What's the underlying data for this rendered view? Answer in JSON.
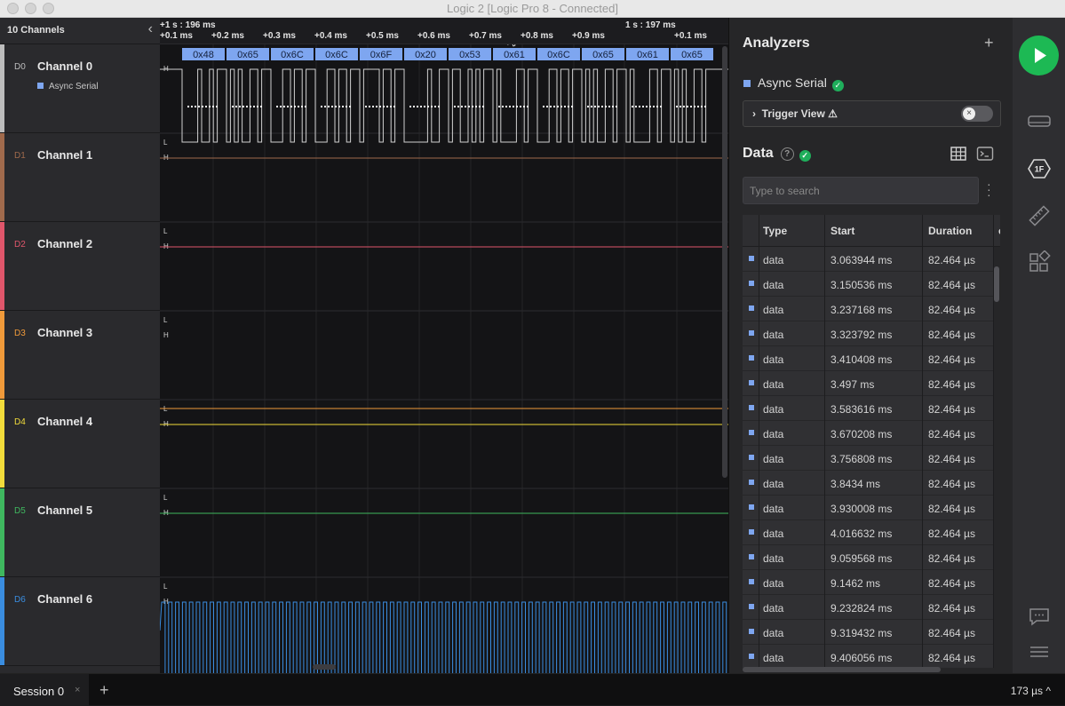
{
  "window": {
    "title": "Logic 2 [Logic Pro 8 - Connected]"
  },
  "channel_panel": {
    "header": "10 Channels"
  },
  "channels": [
    {
      "id": "D0",
      "name": "Channel 0",
      "color": "#bdbdbd",
      "analyzer": "Async Serial"
    },
    {
      "id": "D1",
      "name": "Channel 1",
      "color": "#a06a4c"
    },
    {
      "id": "D2",
      "name": "Channel 2",
      "color": "#e0566b"
    },
    {
      "id": "D3",
      "name": "Channel 3",
      "color": "#f09a3a"
    },
    {
      "id": "D4",
      "name": "Channel 4",
      "color": "#f2dc3b"
    },
    {
      "id": "D5",
      "name": "Channel 5",
      "color": "#3fb85f"
    },
    {
      "id": "D6",
      "name": "Channel 6",
      "color": "#3a8de0"
    }
  ],
  "ruler": {
    "major": [
      "+1 s : 196 ms",
      "1 s : 197 ms"
    ],
    "ticks": [
      "+0.1 ms",
      "+0.2 ms",
      "+0.3 ms",
      "+0.4 ms",
      "+0.5 ms",
      "+0.6 ms",
      "+0.7 ms",
      "+0.8 ms",
      "+0.9 ms",
      "+0.1 ms"
    ]
  },
  "decoded_bytes": [
    "0x48",
    "0x65",
    "0x6C",
    "0x6C",
    "0x6F",
    "0x20",
    "0x53",
    "0x61",
    "0x6C",
    "0x65",
    "0x61",
    "0x65"
  ],
  "level_labels": {
    "high": "H",
    "low": "L"
  },
  "analyzers_panel": {
    "title": "Analyzers",
    "analyzer_name": "Async Serial",
    "trigger_label": "Trigger View ⚠",
    "data_title": "Data",
    "search_placeholder": "Type to search",
    "columns": [
      "Type",
      "Start",
      "Duration"
    ],
    "rows": [
      [
        "data",
        "3.063944 ms",
        "82.464 µs"
      ],
      [
        "data",
        "3.150536 ms",
        "82.464 µs"
      ],
      [
        "data",
        "3.237168 ms",
        "82.464 µs"
      ],
      [
        "data",
        "3.323792 ms",
        "82.464 µs"
      ],
      [
        "data",
        "3.410408 ms",
        "82.464 µs"
      ],
      [
        "data",
        "3.497 ms",
        "82.464 µs"
      ],
      [
        "data",
        "3.583616 ms",
        "82.464 µs"
      ],
      [
        "data",
        "3.670208 ms",
        "82.464 µs"
      ],
      [
        "data",
        "3.756808 ms",
        "82.464 µs"
      ],
      [
        "data",
        "3.8434 ms",
        "82.464 µs"
      ],
      [
        "data",
        "3.930008 ms",
        "82.464 µs"
      ],
      [
        "data",
        "4.016632 ms",
        "82.464 µs"
      ],
      [
        "data",
        "9.059568 ms",
        "82.464 µs"
      ],
      [
        "data",
        "9.1462 ms",
        "82.464 µs"
      ],
      [
        "data",
        "9.232824 ms",
        "82.464 µs"
      ],
      [
        "data",
        "9.319432 ms",
        "82.464 µs"
      ],
      [
        "data",
        "9.406056 ms",
        "82.464 µs"
      ]
    ]
  },
  "bottom": {
    "session": "Session 0",
    "close": "×",
    "add": "+",
    "zoom": "173 µs ^"
  },
  "rail": {
    "protocol_badge": "1F"
  }
}
